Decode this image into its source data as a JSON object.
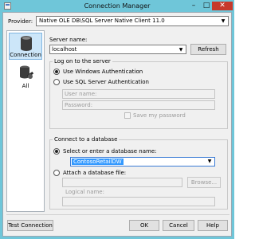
{
  "window": {
    "title": "Connection Manager",
    "minimize_glyph": "–",
    "maximize_glyph": "□",
    "close_glyph": "✕"
  },
  "provider": {
    "label": "Provider:",
    "value": "Native OLE DB\\SQL Server Native Client 11.0"
  },
  "nav": {
    "items": [
      {
        "label": "Connection",
        "icon": "database-icon",
        "selected": true
      },
      {
        "label": "All",
        "icon": "database-tools-icon",
        "selected": false
      }
    ]
  },
  "server": {
    "label": "Server name:",
    "value": "localhost",
    "refresh_label": "Refresh"
  },
  "logon": {
    "title": "Log on to the server",
    "windows_auth_label": "Use Windows Authentication",
    "sql_auth_label": "Use SQL Server Authentication",
    "user_name_label": "User name:",
    "password_label": "Password:",
    "save_password_label": "Save my password",
    "selected": "windows"
  },
  "database": {
    "title": "Connect to a database",
    "select_label": "Select or enter a database name:",
    "selected_db": "ContosoRetailDW",
    "attach_label": "Attach a database file:",
    "browse_label": "Browse...",
    "logical_name_label": "Logical name:"
  },
  "footer": {
    "test_connection_label": "Test Connection",
    "ok_label": "OK",
    "cancel_label": "Cancel",
    "help_label": "Help"
  },
  "colors": {
    "title_bar": "#6fc6d9",
    "close_button": "#c7392b",
    "selection": "#3399ff"
  }
}
